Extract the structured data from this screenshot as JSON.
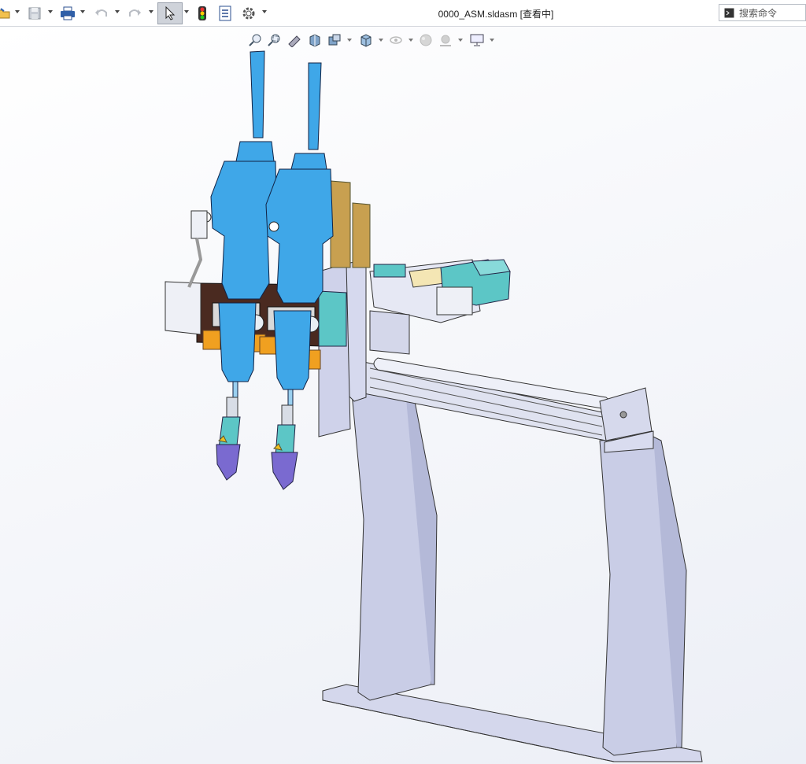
{
  "window": {
    "title": "0000_ASM.sldasm [查看中]"
  },
  "search": {
    "placeholder": "搜索命令"
  },
  "toolbar": {
    "icons": [
      "open-icon",
      "save-icon",
      "print-icon",
      "undo-icon",
      "redo-icon",
      "select-icon",
      "rebuild-icon",
      "file-properties-icon",
      "options-icon"
    ]
  },
  "heads_up_toolbar": {
    "icons": [
      "zoom-to-fit-icon",
      "zoom-to-area-icon",
      "previous-view-icon",
      "section-view-icon",
      "dynamic-annotation-icon",
      "view-orientation-icon",
      "display-style-icon",
      "hide-show-items-icon",
      "edit-appearance-icon",
      "apply-scene-icon",
      "view-settings-icon"
    ]
  },
  "colors": {
    "actuator_blue": "#3fa7e8",
    "frame_gray": "#cbcfe6",
    "brass": "#c8a050",
    "orange": "#f0a020",
    "teal": "#5cc6c6",
    "dark_brown": "#4a2a20"
  }
}
